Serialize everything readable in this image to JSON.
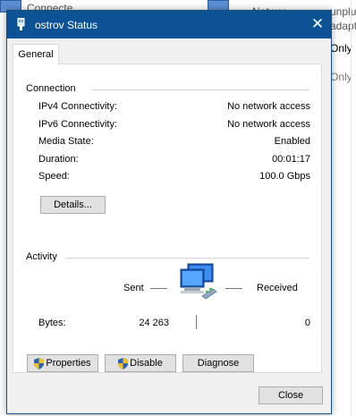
{
  "background": {
    "texts": [
      "Connecte",
      "Networ",
      "unplug",
      "adapte"
    ],
    "only_1": "Only",
    "only_2": "Only"
  },
  "dialog": {
    "title": "ostrov Status",
    "close_glyph": "✕",
    "tab_general": "General",
    "connection": {
      "label": "Connection",
      "rows": [
        {
          "label": "IPv4 Connectivity:",
          "value": "No network access"
        },
        {
          "label": "IPv6 Connectivity:",
          "value": "No network access"
        },
        {
          "label": "Media State:",
          "value": "Enabled"
        },
        {
          "label": "Duration:",
          "value": "00:01:17"
        },
        {
          "label": "Speed:",
          "value": "100.0 Gbps"
        }
      ],
      "details_button": "Details..."
    },
    "activity": {
      "label": "Activity",
      "sent_label": "Sent",
      "received_label": "Received",
      "bytes_label": "Bytes:",
      "bytes_sent": "24 263",
      "bytes_received": "0"
    },
    "buttons": {
      "properties": "Properties",
      "disable": "Disable",
      "diagnose": "Diagnose",
      "close": "Close"
    }
  },
  "colors": {
    "titlebar": "#0b5394",
    "dialog_bg": "#f0f0f0",
    "panel_bg": "#ffffff",
    "button_bg": "#e1e1e1"
  },
  "icons": {
    "window": "network-adapter-icon",
    "close": "close-icon",
    "shield": "uac-shield-icon",
    "network": "network-computers-icon"
  }
}
